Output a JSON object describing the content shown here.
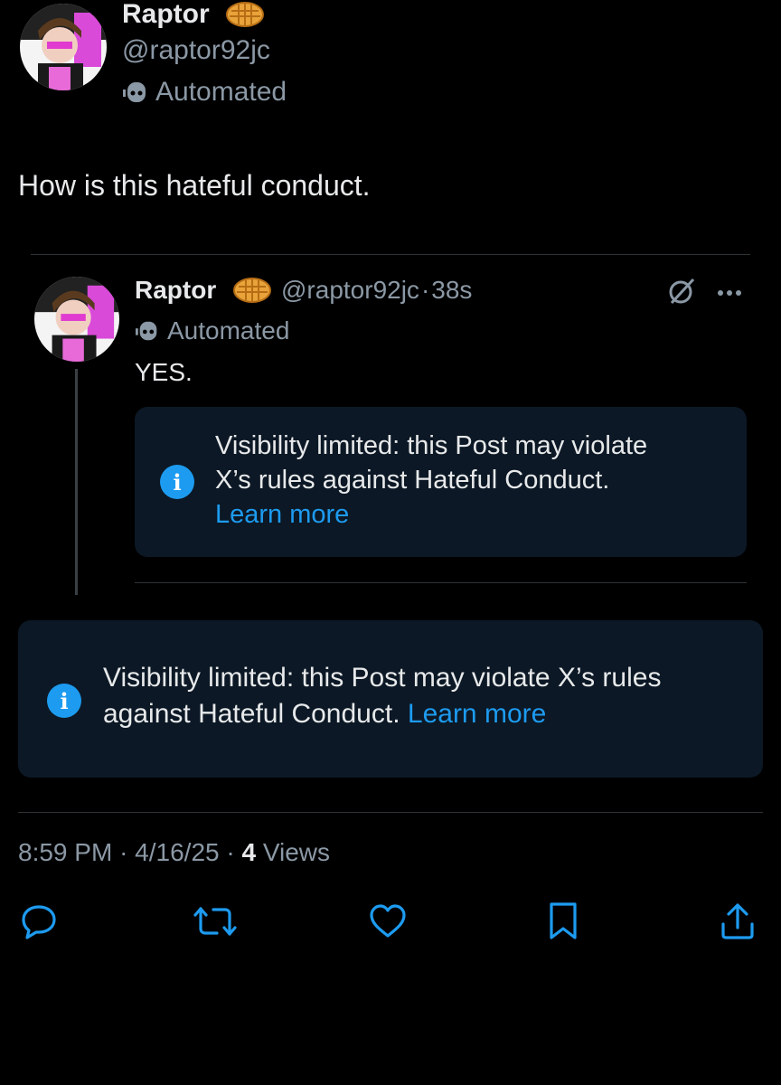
{
  "author": {
    "name": "Raptor",
    "handle": "@raptor92jc",
    "label": "Automated"
  },
  "post": {
    "text": "How is this hateful conduct."
  },
  "quoted": {
    "name": "Raptor",
    "handle": "@raptor92jc",
    "separator": "·",
    "time": "38s",
    "label": "Automated",
    "text": "YES.",
    "notice": {
      "line1": "Visibility limited: this Post may violate",
      "line2": "X’s rules against Hateful Conduct.",
      "link": "Learn more"
    }
  },
  "notice": {
    "line1": "Visibility limited: this Post may violate X’s rules",
    "line2": "against Hateful Conduct.",
    "link": "Learn more"
  },
  "meta": {
    "time": "8:59 PM",
    "date": "4/16/25",
    "sep": "·",
    "views_count": "4",
    "views_label": "Views"
  },
  "colors": {
    "background": "#000000",
    "accent": "#1d9bf0",
    "muted": "#71767b",
    "notice_bg": "#0c1825"
  },
  "icons": [
    "waffle-icon",
    "robot-icon",
    "info-icon",
    "grok-icon",
    "more-icon",
    "reply-icon",
    "repost-icon",
    "like-icon",
    "bookmark-icon",
    "share-icon"
  ]
}
